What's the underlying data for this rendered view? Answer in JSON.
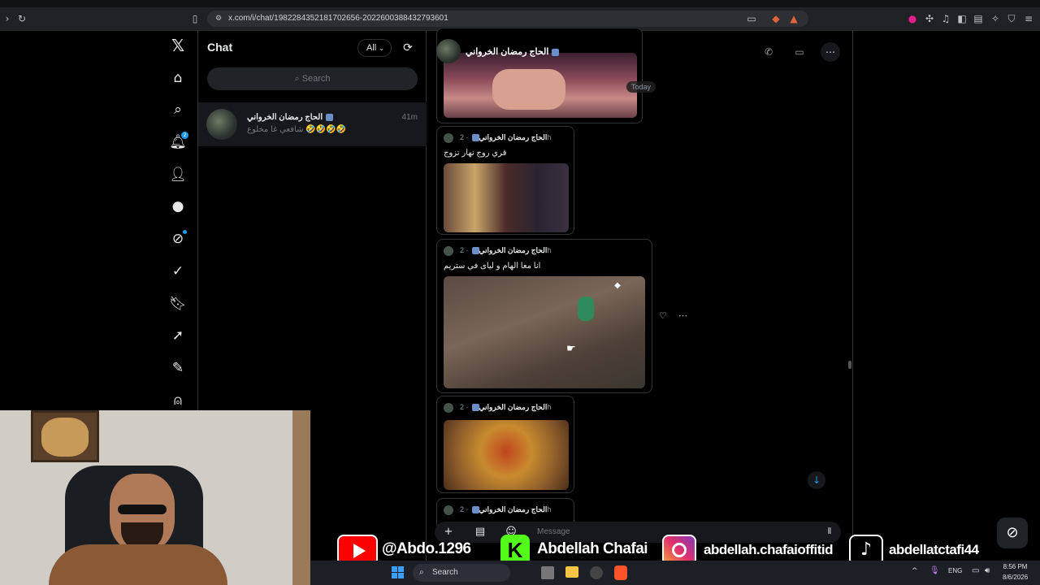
{
  "browser": {
    "url": "x.com/i/chat/1982284352181702656-2022600388432793601"
  },
  "nav": {
    "notification_count": "2"
  },
  "chatlist": {
    "title": "Chat",
    "filter_label": "All",
    "search_placeholder": "Search",
    "conversations": [
      {
        "name": "الحاج رمضان الخرواني",
        "preview": "شافعي غا مخلوع 🤣🤣🤣🤣",
        "time": "41m"
      }
    ]
  },
  "conversation": {
    "header_name": "الحاج رمضان الخرواني",
    "today_label": "Today",
    "messages": [
      {
        "author": "الحاج رمضان الخرواني",
        "time": "· 2h",
        "text": "قري روج نهار تزوج"
      },
      {
        "author": "الحاج رمضان الخرواني",
        "time": "· 2h",
        "text": "انا معا الهام و لياى في ستريم"
      },
      {
        "author": "الحاج رمضان الخرواني",
        "time": "· 2h",
        "text": ""
      },
      {
        "author": "الحاج رمضان الخرواني",
        "time": "· 2h",
        "text": ""
      }
    ],
    "composer_placeholder": "Message"
  },
  "overlay": {
    "youtube": "@Abdo.1296",
    "kick": "Abdellah Chafai",
    "instagram": "abdellah.chafaioffitid",
    "tiktok": "abdellatctafi44"
  },
  "taskbar": {
    "search_label": "Search",
    "language": "ENG",
    "time": "8:56 PM",
    "date": "8/6/2026"
  },
  "colors": {
    "accent": "#1d9bf0",
    "background": "#000000",
    "border": "#2f3336"
  }
}
